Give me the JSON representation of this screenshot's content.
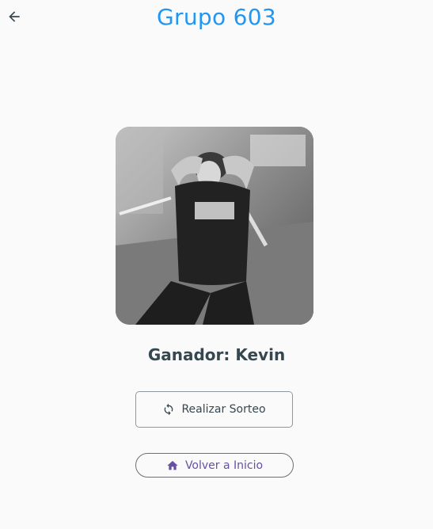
{
  "header": {
    "title": "Grupo 603",
    "back_icon": "arrow-back-icon"
  },
  "main": {
    "winner_photo": "winner-photo",
    "winner_text": "Ganador: Kevin"
  },
  "actions": {
    "draw_label": "Realizar Sorteo",
    "draw_icon": "refresh-icon",
    "home_label": "Volver a Inicio",
    "home_icon": "home-icon"
  },
  "colors": {
    "title": "#2196f3",
    "winner_text": "#37474f",
    "home_accent": "#6750a4",
    "background": "#fafafa"
  }
}
